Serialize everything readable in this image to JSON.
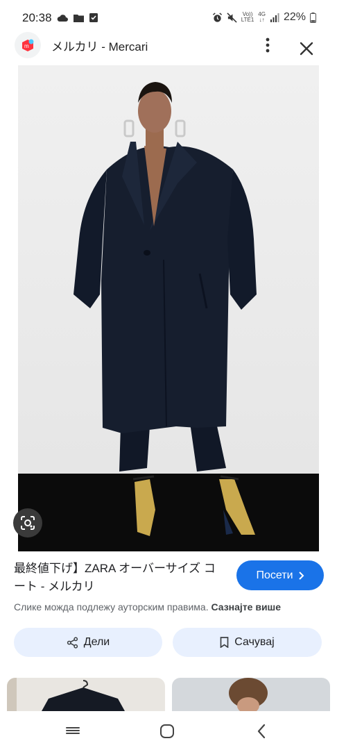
{
  "status_bar": {
    "time": "20:38",
    "volte": "Vo))",
    "lte": "LTE1",
    "network": "4G",
    "battery": "22%"
  },
  "app_bar": {
    "title": "メルカリ - Mercari"
  },
  "result": {
    "caption": "最終値下げ】ZARA オーバーサイズ コート - メルカリ",
    "visit_label": "Посети",
    "copyright_notice": "Слике можда подлежу ауторским правима.",
    "learn_more": "Сазнајте више",
    "share_label": "Дели",
    "save_label": "Сачувај"
  },
  "icons": {
    "status": [
      "cloud-icon",
      "folder-icon",
      "checkbox-icon",
      "alarm-icon",
      "mute-icon",
      "signal-icon",
      "battery-icon"
    ],
    "app": [
      "mercari-logo-icon",
      "more-vert-icon",
      "close-icon"
    ],
    "nav": [
      "recents-icon",
      "home-icon",
      "back-icon"
    ]
  },
  "colors": {
    "accent": "#1a73e8",
    "pill_background": "#e8f0fe",
    "mercari_red": "#ff333f"
  }
}
